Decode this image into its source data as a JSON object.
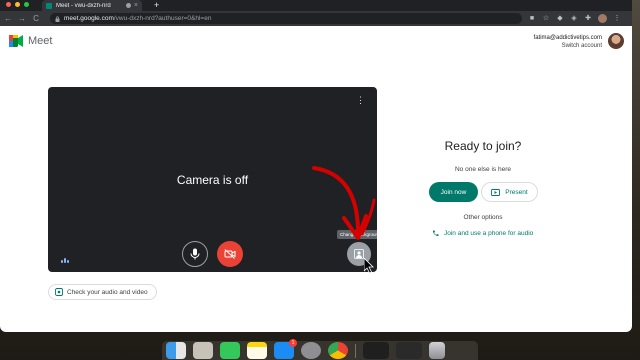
{
  "browser": {
    "tab_title": "Meet - vwu-dxzh-nrd",
    "url_host": "meet.google.com",
    "url_path": "/vwu-dxzh-nrd?authuser=0&hl=en",
    "new_tab_symbol": "+",
    "close_symbol": "×",
    "nav": {
      "back": "←",
      "forward": "→",
      "reload": "C"
    }
  },
  "header": {
    "app_name": "Meet",
    "account_email": "fatima@addictivetips.com",
    "switch_account": "Switch account"
  },
  "preview": {
    "camera_status": "Camera is off",
    "more_icon": "⋮",
    "tooltip": "Change background",
    "check_audio_label": "Check your audio and video"
  },
  "join_panel": {
    "title": "Ready to join?",
    "subtitle": "No one else is here",
    "join_button": "Join now",
    "present_button": "Present",
    "other_options": "Other options",
    "phone_option": "Join and use a phone for audio"
  },
  "dock": {
    "badge_count": "1",
    "apps": [
      "finder-icon",
      "launchpad-icon",
      "messages-icon",
      "notes-icon",
      "app-store-icon",
      "system-preferences-icon",
      "chrome-icon",
      "window-thumbnail",
      "window-thumbnail",
      "trash-icon"
    ]
  },
  "colors": {
    "accent": "#00796b",
    "camera_off_red": "#ea4335",
    "tile_bg": "#202124"
  }
}
